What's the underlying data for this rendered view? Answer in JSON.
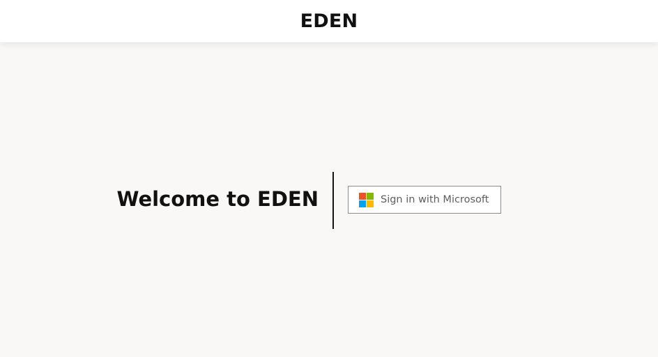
{
  "header": {
    "title": "EDEN"
  },
  "main": {
    "welcome_text": "Welcome to EDEN",
    "signin_button": {
      "label": "Sign in with Microsoft",
      "icon": "microsoft-logo-icon"
    }
  },
  "colors": {
    "page_background": "#faf8f6",
    "header_background": "#ffffff",
    "ms_red": "#f25022",
    "ms_green": "#7fba00",
    "ms_blue": "#00a4ef",
    "ms_yellow": "#ffb900",
    "button_border": "#8c8c8c",
    "button_text": "#5e5e5e"
  }
}
